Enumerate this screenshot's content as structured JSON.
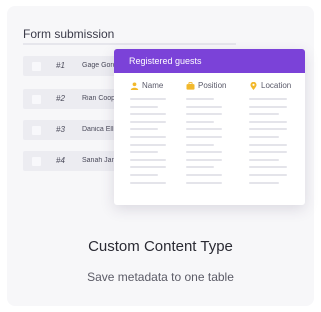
{
  "form": {
    "title": "Form submission",
    "rows": [
      {
        "num": "#1",
        "name": "Gage Gordon"
      },
      {
        "num": "#2",
        "name": "Rian Cooper"
      },
      {
        "num": "#3",
        "name": "Danica Ellis"
      },
      {
        "num": "#4",
        "name": "Sanah James"
      }
    ]
  },
  "guests": {
    "title": "Registered guests",
    "columns": [
      {
        "label": "Name",
        "icon": "person-icon"
      },
      {
        "label": "Position",
        "icon": "briefcase-icon"
      },
      {
        "label": "Location",
        "icon": "location-pin-icon"
      }
    ]
  },
  "feature": {
    "title": "Custom Content Type",
    "subtitle": "Save metadata to one table"
  },
  "colors": {
    "accent": "#7b42d8",
    "icon": "#f2b82b"
  }
}
